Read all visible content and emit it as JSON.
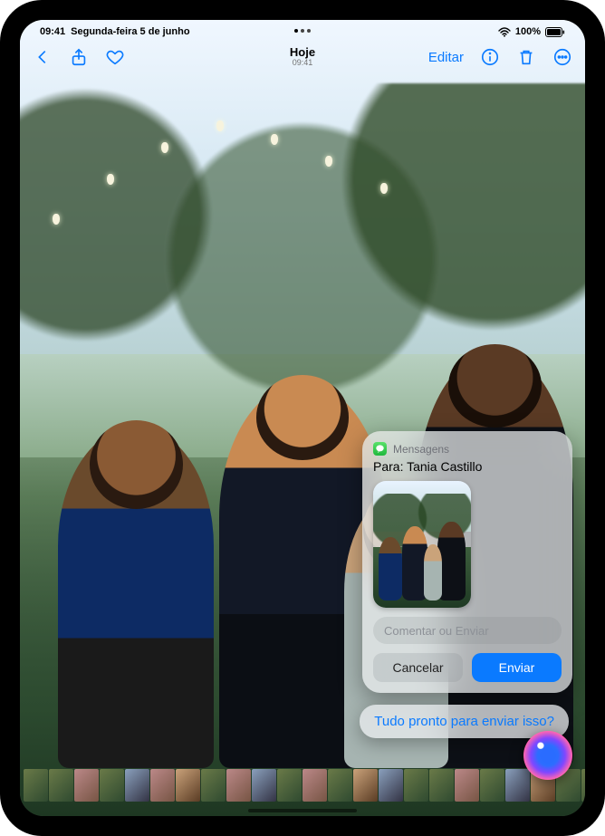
{
  "status": {
    "time": "09:41",
    "date": "Segunda-feira 5 de junho",
    "battery_pct": "100%"
  },
  "toolbar": {
    "title": "Hoje",
    "subtitle": "09:41",
    "edit_label": "Editar"
  },
  "siri_card": {
    "app_name": "Mensagens",
    "to_label": "Para:",
    "to_name": "Tania Castillo",
    "input_placeholder": "Comentar ou Enviar",
    "cancel_label": "Cancelar",
    "send_label": "Enviar"
  },
  "siri_prompt": "Tudo pronto para enviar isso?",
  "colors": {
    "accent": "#0a7aff",
    "messages_green": "#34c759"
  }
}
